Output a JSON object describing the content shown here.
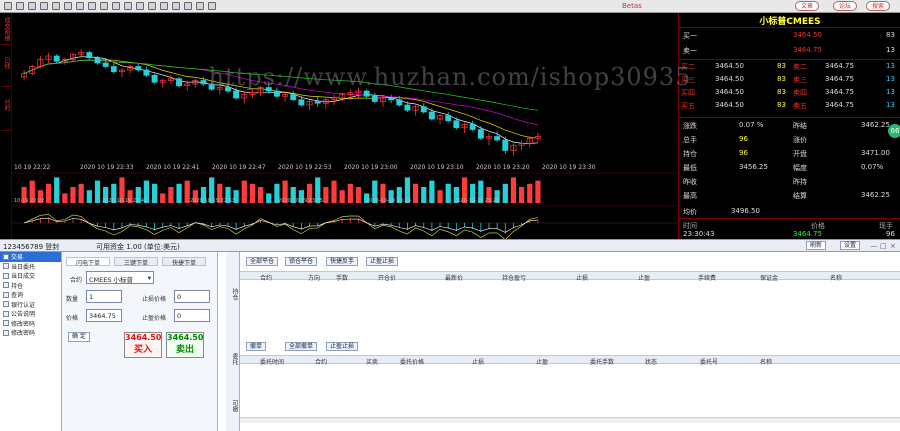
{
  "app_title": "Betas",
  "top_buttons": [
    "文章",
    "论坛",
    "搜索"
  ],
  "left_strip": [
    "成交明细",
    "日线",
    "分时"
  ],
  "chart": {
    "time_labels": [
      "10 19 22:22",
      "2020 10 19 22:33",
      "2020 10 19 22:41",
      "2020 10 19 22:47",
      "2020 10 19 22:53",
      "2020 10 19 23:00",
      "2020 10 19 23:10",
      "2020 10 19 23:20",
      "2020 10 19 23:30"
    ],
    "bottom_labels": [
      "10-19 22:22",
      "2020-10-19 22:41",
      "2020-10-19 22:53",
      "2020-10-19 23:05",
      "2020-10-19 23:14",
      "2020-10-19 23:26"
    ]
  },
  "chart_data": {
    "type": "candlestick",
    "candles": [
      [
        72,
        76,
        70,
        74
      ],
      [
        74,
        79,
        73,
        78
      ],
      [
        78,
        84,
        77,
        82
      ],
      [
        82,
        86,
        80,
        84
      ],
      [
        84,
        85,
        80,
        81
      ],
      [
        81,
        83,
        79,
        82
      ],
      [
        82,
        86,
        81,
        85
      ],
      [
        85,
        88,
        83,
        86
      ],
      [
        86,
        87,
        82,
        83
      ],
      [
        83,
        84,
        79,
        80
      ],
      [
        80,
        82,
        77,
        78
      ],
      [
        78,
        80,
        74,
        75
      ],
      [
        75,
        77,
        72,
        76
      ],
      [
        76,
        79,
        74,
        78
      ],
      [
        78,
        80,
        75,
        76
      ],
      [
        76,
        78,
        72,
        73
      ],
      [
        73,
        74,
        68,
        69
      ],
      [
        69,
        71,
        66,
        70
      ],
      [
        70,
        73,
        68,
        71
      ],
      [
        71,
        72,
        66,
        67
      ],
      [
        67,
        70,
        64,
        68
      ],
      [
        68,
        71,
        66,
        70
      ],
      [
        70,
        72,
        67,
        68
      ],
      [
        68,
        70,
        64,
        65
      ],
      [
        65,
        68,
        62,
        66
      ],
      [
        66,
        69,
        63,
        64
      ],
      [
        64,
        66,
        59,
        60
      ],
      [
        60,
        63,
        57,
        62
      ],
      [
        62,
        65,
        60,
        63
      ],
      [
        63,
        67,
        61,
        66
      ],
      [
        66,
        69,
        63,
        64
      ],
      [
        64,
        66,
        60,
        61
      ],
      [
        61,
        64,
        58,
        62
      ],
      [
        62,
        64,
        58,
        59
      ],
      [
        59,
        61,
        55,
        56
      ],
      [
        56,
        59,
        53,
        58
      ],
      [
        58,
        61,
        55,
        57
      ],
      [
        57,
        60,
        54,
        59
      ],
      [
        59,
        62,
        56,
        60
      ],
      [
        60,
        63,
        58,
        62
      ],
      [
        62,
        65,
        59,
        63
      ],
      [
        63,
        66,
        60,
        64
      ],
      [
        64,
        65,
        60,
        61
      ],
      [
        61,
        63,
        57,
        58
      ],
      [
        58,
        61,
        55,
        60
      ],
      [
        60,
        62,
        57,
        59
      ],
      [
        59,
        61,
        55,
        56
      ],
      [
        56,
        58,
        52,
        53
      ],
      [
        53,
        56,
        50,
        55
      ],
      [
        55,
        57,
        51,
        52
      ],
      [
        52,
        54,
        47,
        48
      ],
      [
        48,
        51,
        45,
        50
      ],
      [
        50,
        52,
        46,
        47
      ],
      [
        47,
        49,
        42,
        43
      ],
      [
        43,
        46,
        40,
        45
      ],
      [
        45,
        47,
        41,
        42
      ],
      [
        42,
        44,
        36,
        37
      ],
      [
        37,
        40,
        33,
        38
      ],
      [
        38,
        41,
        35,
        36
      ],
      [
        36,
        38,
        28,
        30
      ],
      [
        30,
        34,
        27,
        33
      ],
      [
        33,
        36,
        30,
        34
      ],
      [
        34,
        38,
        32,
        37
      ],
      [
        37,
        40,
        35,
        38
      ]
    ],
    "volumes": [
      5,
      7,
      4,
      6,
      8,
      3,
      5,
      6,
      4,
      7,
      5,
      6,
      8,
      4,
      5,
      7,
      6,
      3,
      5,
      6,
      7,
      4,
      5,
      8,
      6,
      5,
      4,
      7,
      6,
      5,
      3,
      6,
      7,
      5,
      4,
      6,
      8,
      5,
      7,
      4,
      6,
      5,
      3,
      7,
      6,
      4,
      5,
      8,
      6,
      5,
      7,
      4,
      6,
      5,
      8,
      6,
      7,
      5,
      4,
      6,
      8,
      5,
      6,
      7
    ]
  },
  "quote": {
    "title": "小标普CMEES",
    "buy1_label": "买一",
    "buy1_price": "3464.50",
    "buy1_vol": "83",
    "sell1_label": "卖一",
    "sell1_price": "3464.75",
    "sell1_vol": "13",
    "depth": [
      {
        "bl": "买二",
        "bp": "3464.50",
        "bv": "83",
        "sl": "卖二",
        "sp": "3464.75",
        "sv": "13"
      },
      {
        "bl": "买三",
        "bp": "3464.50",
        "bv": "83",
        "sl": "卖三",
        "sp": "3464.75",
        "sv": "13"
      },
      {
        "bl": "买四",
        "bp": "3464.50",
        "bv": "83",
        "sl": "卖四",
        "sp": "3464.75",
        "sv": "13"
      },
      {
        "bl": "买五",
        "bp": "3464.50",
        "bv": "83",
        "sl": "卖五",
        "sp": "3464.75",
        "sv": "13"
      }
    ],
    "stats": [
      {
        "l1": "涨跌",
        "v1": "0.07 %",
        "l2": "昨结",
        "v2": "3462.25"
      },
      {
        "l1": "总手",
        "v1": "96",
        "l2": "涨价",
        "v2": ""
      },
      {
        "l1": "持仓",
        "v1": "96",
        "l2": "开盘",
        "v2": "3471.00"
      },
      {
        "l1": "最低",
        "v1": "3456.25",
        "l2": "幅度",
        "v2": "0.07%"
      },
      {
        "l1": "昨收",
        "v1": "",
        "l2": "昨持",
        "v2": ""
      },
      {
        "l1": "最高",
        "v1": "",
        "l2": "结算",
        "v2": "3462.25"
      }
    ],
    "last_label": "均价",
    "last_value": "3496.50",
    "foot_labels": [
      "时间",
      "价格",
      "现手"
    ],
    "foot_values": [
      "23:30:43",
      "3464.75",
      "96"
    ]
  },
  "statusbar": {
    "account": "123456789 登封",
    "funds": "可用资金 1.00 (单位:美元)",
    "right_buttons": [
      "刷新",
      "设置"
    ]
  },
  "nav": [
    "交易",
    "当日委托",
    "当日成交",
    "持仓",
    "查询",
    "银行认证",
    "公告说明",
    "修改密码",
    "修改密码"
  ],
  "order": {
    "tabs": [
      "闪电下单",
      "三键下单",
      "快捷下单"
    ],
    "contract_label": "合约",
    "contract_value": "CMEES 小标普",
    "qty_label": "数量",
    "qty_value": "1",
    "stop_loss_label": "止损价格",
    "stop_loss_value": "0",
    "price_label": "价格",
    "price_value": "3464.75",
    "take_profit_label": "止盈价格",
    "take_profit_value": "0",
    "ok_button": "确 定",
    "buy_price": "3464.50",
    "buy_label": "买入",
    "sell_price": "3464.50",
    "sell_label": "卖出"
  },
  "vtabs": [
    "持仓",
    "委托",
    "可撤"
  ],
  "grid": {
    "top_buttons": [
      "全部平仓",
      "锁仓平仓",
      "快捷反手",
      "止盈止损"
    ],
    "top_headers": [
      "合约",
      "方向",
      "手数",
      "开仓价",
      "最新价",
      "持仓盈亏",
      "止损",
      "止盈",
      "手续费",
      "保证金",
      "名称"
    ],
    "bottom_buttons": [
      "撤单",
      "全部撤单",
      "止盈止损"
    ],
    "bottom_headers": [
      "委托时间",
      "合约",
      "买卖",
      "委托价格",
      "止损",
      "止盈",
      "委托手数",
      "状态",
      "委托号",
      "名称"
    ]
  },
  "watermark": "https://www.huzhan.com/ishop30935",
  "fab": "66"
}
